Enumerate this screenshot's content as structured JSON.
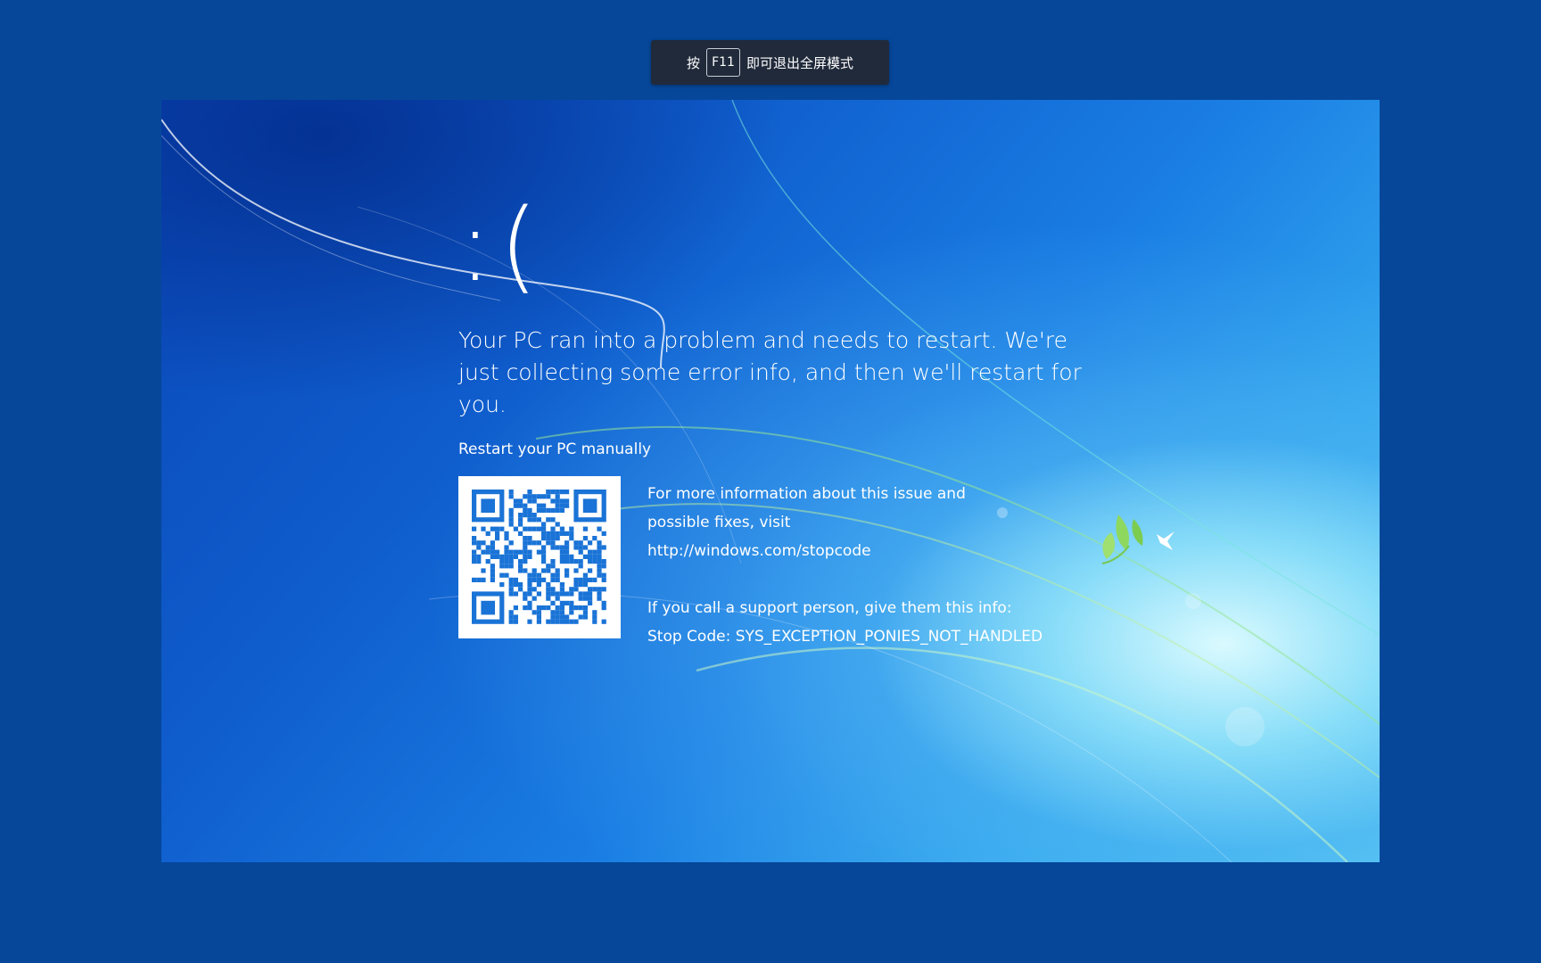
{
  "fullscreen_hint": {
    "prefix": "按",
    "key": "F11",
    "suffix": "即可退出全屏模式"
  },
  "bsod": {
    "sad_face": ":(",
    "headline": "Your PC ran into a problem and needs to restart. We're just collecting some error info, and then we'll restart for you.",
    "restart_manually": "Restart your PC manually",
    "more_info_line1": "For more information about this issue and",
    "more_info_line2": "possible fixes, visit",
    "url": "http://windows.com/stopcode",
    "support_line": "If you call a support person, give them this info:",
    "stop_code": "Stop Code: SYS_EXCEPTION_PONIES_NOT_HANDLED"
  },
  "colors": {
    "frame_background": "#06479a",
    "hint_background": "#202a3a",
    "qr_module": "#1a73d6",
    "text": "#ffffff"
  },
  "icons": {
    "qr": "qr-code-icon",
    "birds": "bird-icon"
  }
}
